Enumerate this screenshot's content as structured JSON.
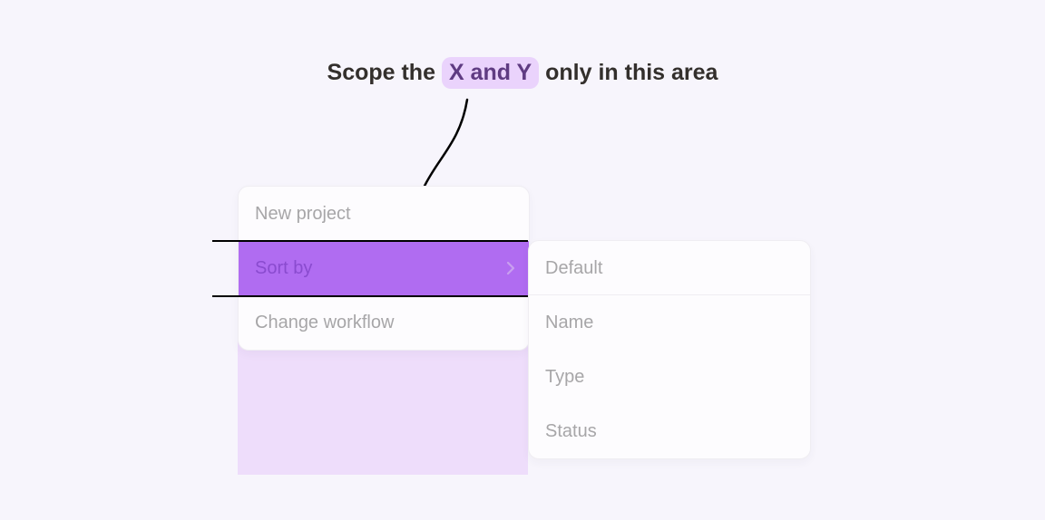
{
  "heading": {
    "before": "Scope the ",
    "highlight": "X and Y",
    "after": " only in this area"
  },
  "menu": {
    "items": [
      {
        "label": "New project"
      },
      {
        "label": "Sort by",
        "active": true,
        "hasSubmenu": true
      },
      {
        "label": "Change workflow"
      }
    ]
  },
  "submenu": {
    "head": "Default",
    "items": [
      {
        "label": "Name"
      },
      {
        "label": "Type"
      },
      {
        "label": "Status"
      }
    ]
  }
}
